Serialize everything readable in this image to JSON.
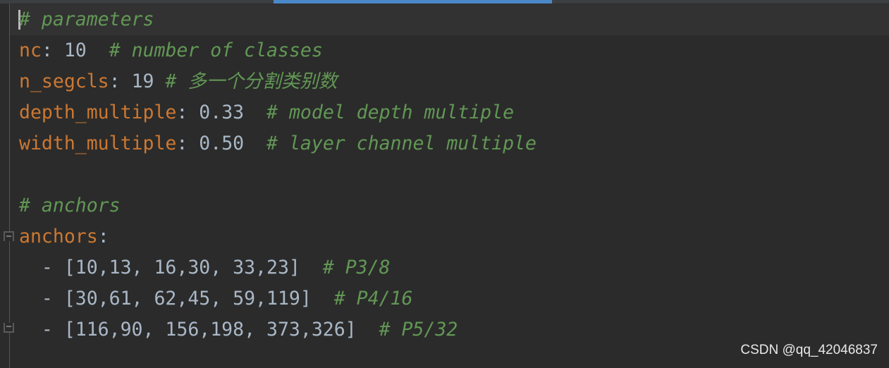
{
  "editor": {
    "lines": [
      {
        "comment": "# parameters"
      },
      {
        "key": "nc",
        "sep": ": ",
        "value": "10",
        "gap": "  ",
        "comment": "# number of classes"
      },
      {
        "key": "n_segcls",
        "sep": ": ",
        "value": "19",
        "gap": " ",
        "comment": "# 多一个分割类别数"
      },
      {
        "key": "depth_multiple",
        "sep": ": ",
        "value": "0.33",
        "gap": "  ",
        "comment": "# model depth multiple"
      },
      {
        "key": "width_multiple",
        "sep": ": ",
        "value": "0.50",
        "gap": "  ",
        "comment": "# layer channel multiple"
      },
      {
        "comment": "# anchors"
      },
      {
        "key": "anchors",
        "sep": ":"
      },
      {
        "value": "  - [10,13, 16,30, 33,23]",
        "gap": "  ",
        "comment": "# P3/8"
      },
      {
        "value": "  - [30,61, 62,45, 59,119]",
        "gap": "  ",
        "comment": "# P4/16"
      },
      {
        "value": "  - [116,90, 156,198, 373,326]",
        "gap": "  ",
        "comment": "# P5/32"
      }
    ]
  },
  "watermark": "CSDN @qq_42046837"
}
